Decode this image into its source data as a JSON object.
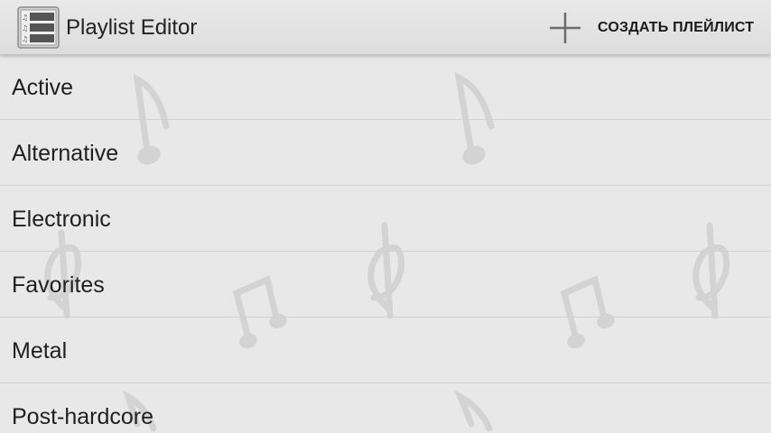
{
  "header": {
    "title": "Playlist Editor",
    "app_icon": "playlist-icon",
    "create_label": "СОЗДАТЬ ПЛЕЙЛИСТ",
    "create_icon": "plus-icon"
  },
  "playlists": [
    {
      "label": "Active"
    },
    {
      "label": "Alternative"
    },
    {
      "label": "Electronic"
    },
    {
      "label": "Favorites"
    },
    {
      "label": "Metal"
    },
    {
      "label": "Post-hardcore"
    }
  ],
  "colors": {
    "background": "#e8e8e8",
    "divider": "#d1d1d1",
    "text": "#1f1f1f",
    "watermark": "#d4d4d4"
  }
}
